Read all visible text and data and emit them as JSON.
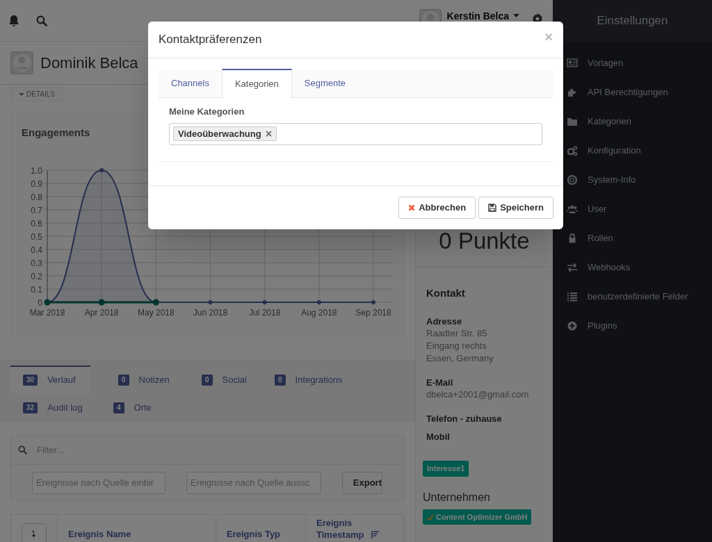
{
  "topbar": {
    "user_name": "Kerstin Belca"
  },
  "contact": {
    "name": "Dominik Belca",
    "details_button": "DETAILS"
  },
  "engagements": {
    "title": "Engagements",
    "chart_data": {
      "type": "line",
      "categories": [
        "Mar 2018",
        "Apr 2018",
        "May 2018",
        "Jun 2018",
        "Jul 2018",
        "Aug 2018",
        "Sep 2018"
      ],
      "grid": true,
      "series": [
        {
          "color": "#4e5d9d",
          "marker": true,
          "values": [
            0,
            1,
            0,
            0,
            0,
            0,
            0
          ]
        },
        {
          "color": "#00695c",
          "marker": true,
          "values": [
            0,
            0,
            0,
            null,
            null,
            null,
            null
          ]
        }
      ],
      "ylim": [
        0,
        1
      ],
      "yticks": [
        0,
        0.1,
        0.2,
        0.3,
        0.4,
        0.5,
        0.6,
        0.7,
        0.8,
        0.9,
        {
          "value": 1,
          "label": "1.0"
        }
      ]
    }
  },
  "tabs": [
    {
      "label": "Verlauf",
      "count": "30",
      "selected": true
    },
    {
      "label": "Notizen",
      "count": "0",
      "selected": false
    },
    {
      "label": "Social",
      "count": "0",
      "selected": false
    },
    {
      "label": "Integrations",
      "count": "0",
      "selected": false
    },
    {
      "label": "Audit log",
      "count": "32",
      "selected": false
    },
    {
      "label": "Orte",
      "count": "4",
      "selected": false
    }
  ],
  "filter": {
    "placeholder": "Filter...",
    "source_include": {
      "placeholder": "Ereignisse nach Quelle einbir"
    },
    "source_exclude": {
      "placeholder": "Ereignisse nach Quelle aussc"
    },
    "export_button": "Export"
  },
  "table": {
    "columns": [
      "Ereignis Name",
      "Ereignis Typ",
      "Ereignis Timestamp"
    ]
  },
  "points": "0 Punkte",
  "contact_info": {
    "title": "Kontakt",
    "fields": [
      {
        "label": "Adresse",
        "lines": [
          "Raadter Str. 85",
          "Eingang rechts",
          "Essen, Germany"
        ]
      },
      {
        "label": "E-Mail",
        "lines": [
          "dbelca+2001@gmail.com"
        ]
      },
      {
        "label": "Telefon - zuhause"
      },
      {
        "label": "Mobil"
      }
    ]
  },
  "tags": [
    {
      "label": "Interesse1"
    }
  ],
  "companies_title": "Unternehmen",
  "companies": [
    {
      "label": "Content Optimizer GmbH"
    }
  ],
  "settings": {
    "title": "Einstellungen",
    "items": [
      {
        "label": "Vorlagen"
      },
      {
        "label": "API Berechtigungen"
      },
      {
        "label": "Kategorien"
      },
      {
        "label": "Konfiguration"
      },
      {
        "label": "System-Info"
      },
      {
        "label": "User"
      },
      {
        "label": "Rollen"
      },
      {
        "label": "Webhooks"
      },
      {
        "label": "benutzerdefinierte Felder"
      },
      {
        "label": "Plugins"
      }
    ]
  },
  "modal": {
    "title": "Kontaktpräferenzen",
    "close": "×",
    "tabs": [
      {
        "label": "Channels",
        "selected": false
      },
      {
        "label": "Kategorien",
        "selected": true
      },
      {
        "label": "Segmente",
        "selected": false
      }
    ],
    "field_label": "Meine Kategorien",
    "selected_categories": [
      {
        "label": "Videoüberwachung"
      }
    ],
    "buttons": [
      {
        "label": "Abbrechen",
        "kind": "cancel"
      },
      {
        "label": "Speichern",
        "kind": "save"
      }
    ]
  }
}
